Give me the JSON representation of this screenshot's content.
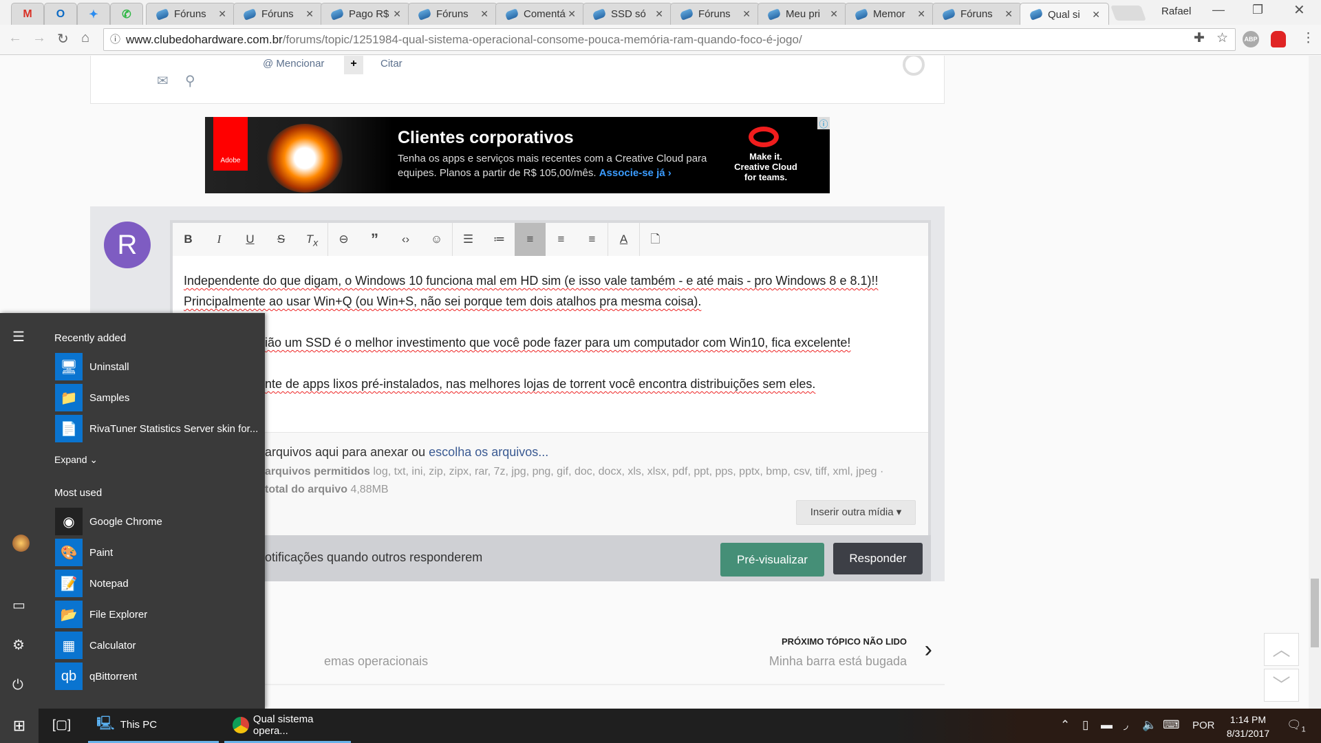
{
  "browser": {
    "pinned_tabs": [
      {
        "icon": "gmail-icon",
        "glyph": "M",
        "color": "#d93025"
      },
      {
        "icon": "outlook-icon",
        "glyph": "O",
        "color": "#0b6ac4"
      },
      {
        "icon": "messenger-icon",
        "glyph": "✦",
        "color": "#2a8cf0"
      },
      {
        "icon": "whatsapp-icon",
        "glyph": "✆",
        "color": "#2cb742"
      }
    ],
    "tabs": [
      {
        "title": "Fóruns"
      },
      {
        "title": "Fóruns"
      },
      {
        "title": "Pago R$"
      },
      {
        "title": "Fóruns"
      },
      {
        "title": "Comentários"
      },
      {
        "title": "SSD só"
      },
      {
        "title": "Fóruns"
      },
      {
        "title": "Meu pri"
      },
      {
        "title": "Memor"
      },
      {
        "title": "Fóruns"
      },
      {
        "title": "Qual si",
        "active": true
      }
    ],
    "profile": "Rafael",
    "url_host": "www.clubedohardware.com.br",
    "url_path": "/forums/topic/1251984-qual-sistema-operacional-consome-pouca-memória-ram-quando-foco-é-jogo/",
    "extensions": [
      "extension-blocked-icon",
      "bookmark-star-icon",
      "adblock-plus-icon",
      "vpn-lock-icon",
      "menu-icon"
    ],
    "abp_label": "ABP"
  },
  "post_actions": {
    "mention": "@ Mencionar",
    "plus": "+",
    "quote": "Citar"
  },
  "ad": {
    "title": "Clientes corporativos",
    "line1": "Tenha os apps e serviços mais recentes com a Creative Cloud para",
    "line2": "equipes. Planos a partir de R$ 105,00/mês.",
    "cta": "Associe-se já ›",
    "brand": "Adobe",
    "tagline1": "Make it.",
    "tagline2": "Creative Cloud",
    "tagline3": "for teams."
  },
  "reply": {
    "avatar_letter": "R",
    "avatar_color": "#7e5cc2",
    "lines": [
      "Independente do que digam, o Windows 10 funciona mal em HD sim (e isso vale também - e até mais - pro Windows 8 e 8.1)!!",
      "Principalmente ao usar Win+Q (ou Win+S, não sei porque tem dois atalhos pra mesma coisa).",
      "ião um SSD é o melhor investimento que você pode fazer para um computador com Win10, fica excelente!",
      "nte de apps lixos pré-instalados, nas melhores lojas de torrent você encontra distribuições sem eles."
    ],
    "attach_text": "arquivos aqui para anexar ou",
    "attach_link": "escolha os arquivos...",
    "allowed_label": "arquivos permitidos",
    "allowed_list": "log, txt, ini, zip, zipx, rar, 7z, jpg, png, gif, doc, docx, xls, xlsx, pdf, ppt, pps, pptx, bmp, csv, tiff, xml, jpeg ·",
    "size_label": "total do arquivo",
    "size_value": "4,88MB",
    "insert_media": "Inserir outra mídia ▾",
    "notify": "otificações quando outros responderem",
    "preview": "Pré-visualizar",
    "submit": "Responder",
    "preview_color": "#458f77",
    "submit_color": "#3d3f46"
  },
  "next_topic": {
    "label": "PRÓXIMO TÓPICO NÃO LIDO",
    "title": "Minha barra está bugada",
    "prev_partial": "emas operacionais"
  },
  "start_menu": {
    "recently_added": "Recently added",
    "recent": [
      {
        "label": "Uninstall",
        "icon": "monitor-icon",
        "glyph": "🖥"
      },
      {
        "label": "Samples",
        "icon": "folder-icon",
        "glyph": "📁"
      },
      {
        "label": "RivaTuner Statistics Server skin for...",
        "icon": "pdf-icon",
        "glyph": "📄"
      }
    ],
    "expand": "Expand ⌄",
    "most_used": "Most used",
    "apps": [
      {
        "label": "Google Chrome",
        "icon": "chrome-icon",
        "glyph": "◉"
      },
      {
        "label": "Paint",
        "icon": "paint-icon",
        "glyph": "🎨"
      },
      {
        "label": "Notepad",
        "icon": "notepad-icon",
        "glyph": "📝"
      },
      {
        "label": "File Explorer",
        "icon": "file-explorer-icon",
        "glyph": "📂"
      },
      {
        "label": "Calculator",
        "icon": "calculator-icon",
        "glyph": "▦"
      },
      {
        "label": "qBittorrent",
        "icon": "qbittorrent-icon",
        "glyph": "qb"
      }
    ]
  },
  "taskbar": {
    "this_pc": "This PC",
    "chrome": "Qual sistema opera...",
    "lang": "POR",
    "time": "1:14 PM",
    "date": "8/31/2017",
    "notifications": "1"
  }
}
